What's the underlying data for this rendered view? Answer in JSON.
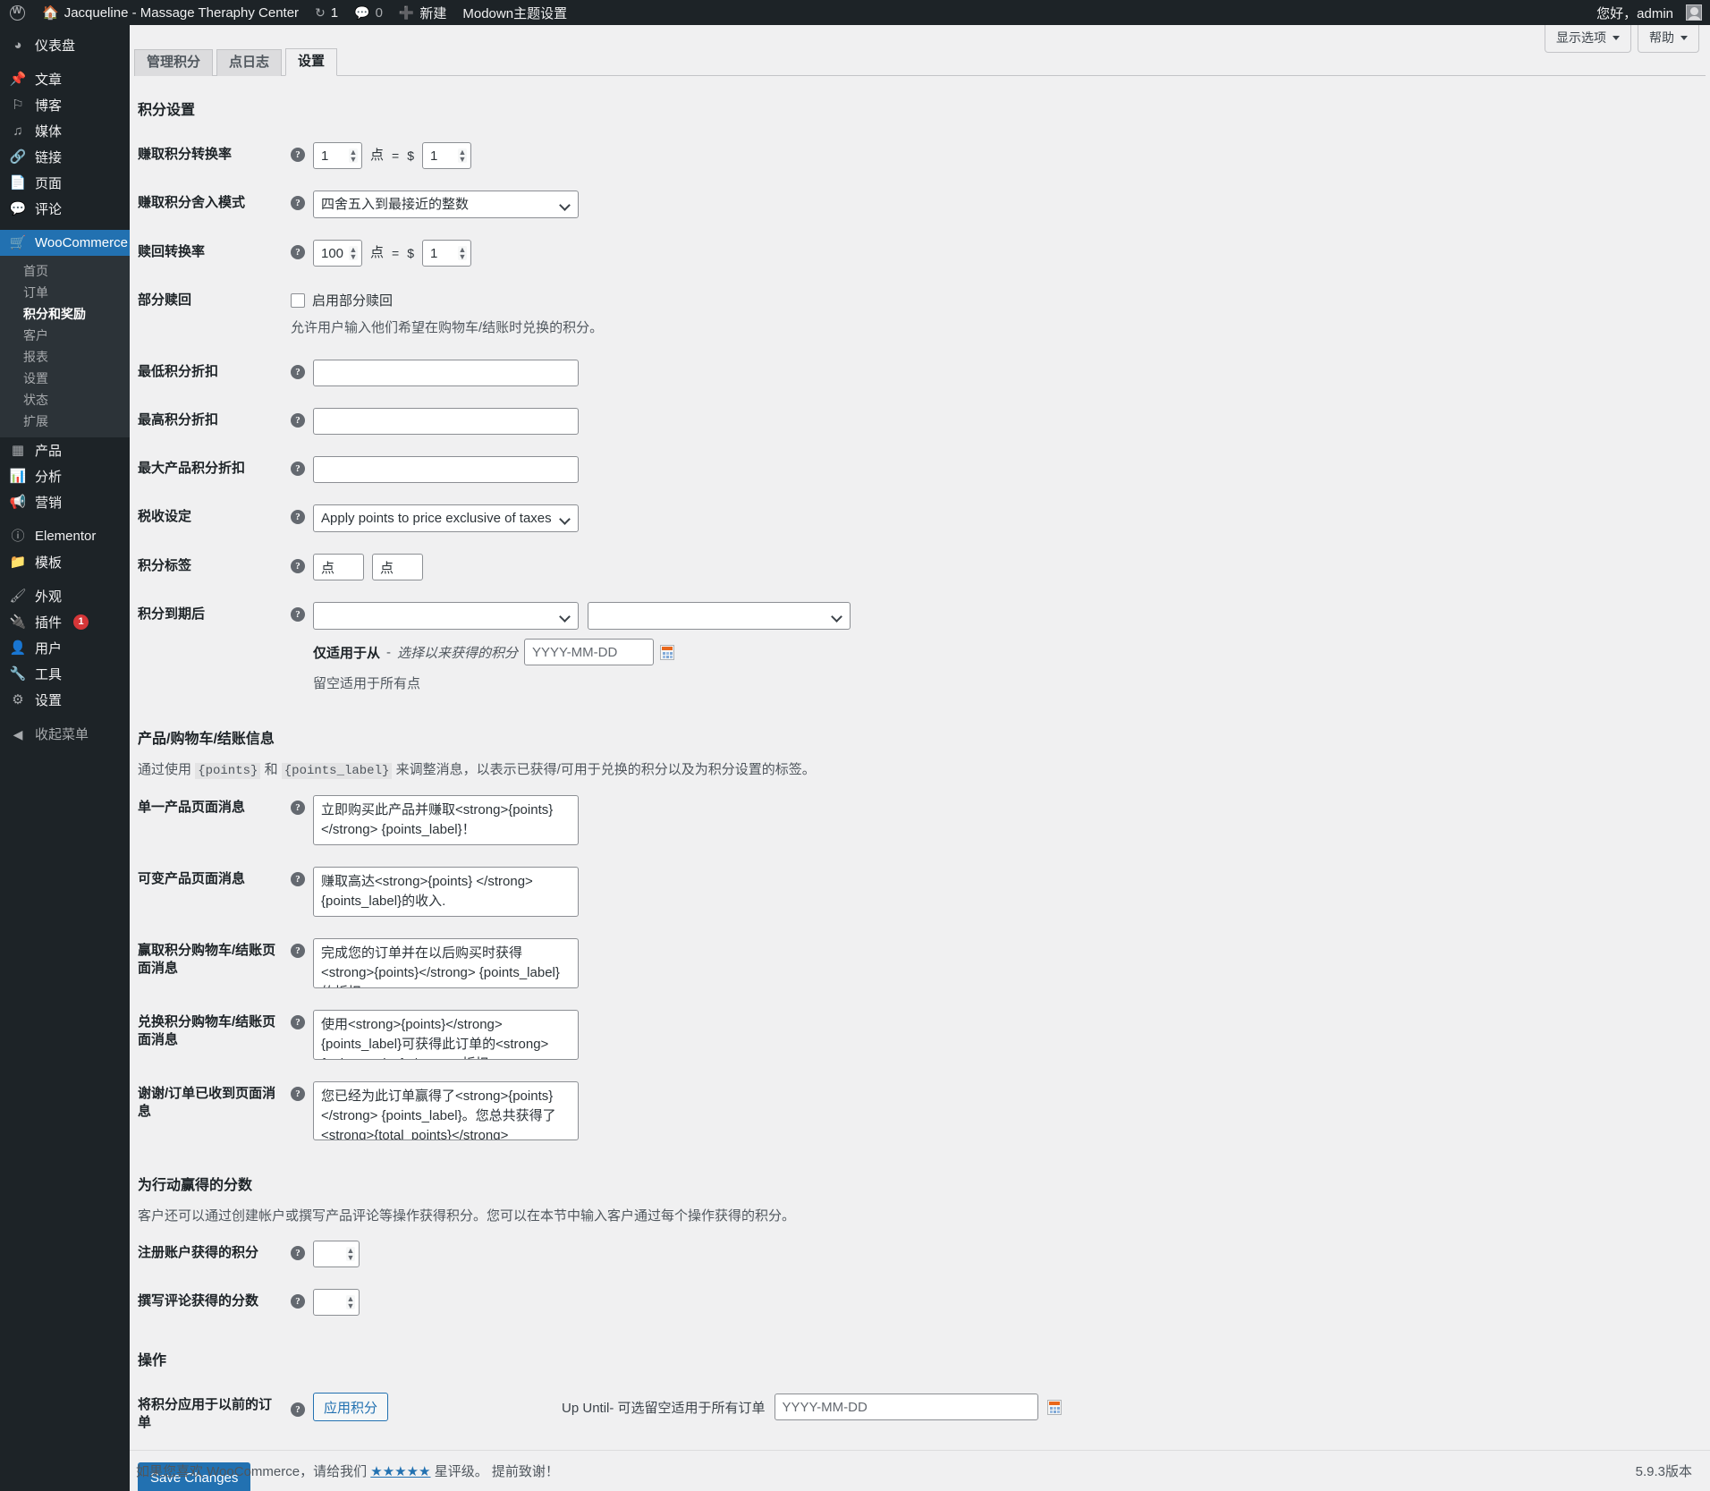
{
  "adminbar": {
    "wp_logo": "wordpress-logo-icon",
    "site_name": "Jacqueline - Massage Theraphy Center",
    "updates_icon": "updates-icon",
    "updates_count": "1",
    "comments_icon": "comments-icon",
    "comments_count": "0",
    "new_icon": "plus-icon",
    "new_label": "新建",
    "theme_settings_label": "Modown主题设置",
    "greeting": "您好，admin",
    "avatar": "avatar-icon"
  },
  "sidebar": {
    "items": [
      {
        "label": "仪表盘",
        "icon": "dashboard-icon"
      },
      {
        "label": "文章",
        "icon": "pin-icon"
      },
      {
        "label": "博客",
        "icon": "flag-icon"
      },
      {
        "label": "媒体",
        "icon": "media-icon"
      },
      {
        "label": "链接",
        "icon": "link-icon"
      },
      {
        "label": "页面",
        "icon": "pages-icon"
      },
      {
        "label": "评论",
        "icon": "comment-icon"
      },
      {
        "label": "WooCommerce",
        "icon": "woocommerce-icon"
      },
      {
        "label": "产品",
        "icon": "products-icon"
      },
      {
        "label": "分析",
        "icon": "analytics-icon"
      },
      {
        "label": "营销",
        "icon": "marketing-icon"
      },
      {
        "label": "Elementor",
        "icon": "elementor-icon"
      },
      {
        "label": "模板",
        "icon": "templates-icon"
      },
      {
        "label": "外观",
        "icon": "appearance-icon"
      },
      {
        "label": "插件",
        "icon": "plugins-icon",
        "badge": "1"
      },
      {
        "label": "用户",
        "icon": "users-icon"
      },
      {
        "label": "工具",
        "icon": "tools-icon"
      },
      {
        "label": "设置",
        "icon": "settings-icon"
      },
      {
        "label": "收起菜单",
        "icon": "collapse-icon"
      }
    ],
    "woocommerce_submenu": [
      {
        "label": "首页"
      },
      {
        "label": "订单"
      },
      {
        "label": "积分和奖励"
      },
      {
        "label": "客户"
      },
      {
        "label": "报表"
      },
      {
        "label": "设置"
      },
      {
        "label": "状态"
      },
      {
        "label": "扩展"
      }
    ]
  },
  "screen_meta": {
    "screen_options_label": "显示选项",
    "help_label": "帮助"
  },
  "tabs": [
    {
      "label": "管理积分",
      "active": false
    },
    {
      "label": "点日志",
      "active": false
    },
    {
      "label": "设置",
      "active": true
    }
  ],
  "points_settings": {
    "heading": "积分设置",
    "earn_conversion": {
      "label": "赚取积分转换率",
      "points_value": "1",
      "points_unit": "点",
      "equals": "=",
      "currency": "$",
      "amount_value": "1"
    },
    "earn_rounding": {
      "label": "赚取积分舍入模式",
      "value": "四舍五入到最接近的整数"
    },
    "redeem_conversion": {
      "label": "赎回转换率",
      "points_value": "100",
      "points_unit": "点",
      "equals": "=",
      "currency": "$",
      "amount_value": "1"
    },
    "partial_redemption": {
      "label": "部分赎回",
      "checkbox_label": "启用部分赎回",
      "checked": false,
      "description": "允许用户输入他们希望在购物车/结账时兑换的积分。"
    },
    "min_discount": {
      "label": "最低积分折扣",
      "value": ""
    },
    "max_discount": {
      "label": "最高积分折扣",
      "value": ""
    },
    "max_product_discount": {
      "label": "最大产品积分折扣",
      "value": ""
    },
    "tax_setting": {
      "label": "税收设定",
      "value": "Apply points to price exclusive of taxes."
    },
    "points_label_field": {
      "label": "积分标签",
      "singular": "点",
      "plural": "点"
    },
    "points_expire": {
      "label": "积分到期后",
      "select1_value": "",
      "select2_value": "",
      "apply_prefix": "仅适用于从",
      "apply_dash": "-",
      "apply_italic": "选择以来获得的积分",
      "date_placeholder": "YYYY-MM-DD",
      "date_value": "",
      "calendar_icon": "calendar-icon",
      "hint": "留空适用于所有点"
    }
  },
  "messages_section": {
    "heading": "产品/购物车/结账信息",
    "desc_part1": "通过使用",
    "token1": "{points}",
    "desc_and": "和",
    "token2": "{points_label}",
    "desc_part2": "来调整消息，以表示已获得/可用于兑换的积分以及为积分设置的标签。",
    "single_product": {
      "label": "单一产品页面消息",
      "value": "立即购买此产品并赚取<strong>{points}</strong> {points_label}！"
    },
    "variable_product": {
      "label": "可变产品页面消息",
      "value": "赚取高达<strong>{points} </strong> {points_label}的收入."
    },
    "earn_cart": {
      "label": "赢取积分购物车/结账页面消息",
      "value": "完成您的订单并在以后购买时获得<strong>{points}</strong> {points_label}的折扣"
    },
    "redeem_cart": {
      "label": "兑换积分购物车/结账页面消息",
      "value": "使用<strong>{points}</strong> {points_label}可获得此订单的<strong>{points_value}</strong>折扣!"
    },
    "thank_you": {
      "label": "谢谢/订单已收到页面消息",
      "value": "您已经为此订单赢得了<strong>{points}</strong> {points_label}。您总共获得了<strong>{total_points}</strong> {total_points_label}。"
    }
  },
  "actions_points_section": {
    "heading": "为行动赢得的分数",
    "description": "客户还可以通过创建帐户或撰写产品评论等操作获得积分。您可以在本节中输入客户通过每个操作获得的积分。",
    "signup_points": {
      "label": "注册账户获得的积分",
      "value": ""
    },
    "review_points": {
      "label": "撰写评论获得的分数",
      "value": ""
    }
  },
  "operations_section": {
    "heading": "操作",
    "apply_previous_orders": {
      "label": "将积分应用于以前的订单",
      "button_label": "应用积分",
      "up_until_label": "Up Until- 可选留空适用于所有订单",
      "date_placeholder": "YYYY-MM-DD",
      "date_value": "",
      "calendar_icon": "calendar-icon"
    },
    "save_label": "Save Changes"
  },
  "footer": {
    "text_before": "如果您喜欢 WooCommerce，请给我们",
    "stars": "★★★★★",
    "text_after": "星评级。 提前致谢！",
    "version": "5.9.3版本"
  },
  "colors": {
    "accent": "#2271b1",
    "sidebar_bg": "#1d2327",
    "submenu_bg": "#2c3338",
    "page_bg": "#f0f0f1",
    "badge": "#d63638"
  }
}
